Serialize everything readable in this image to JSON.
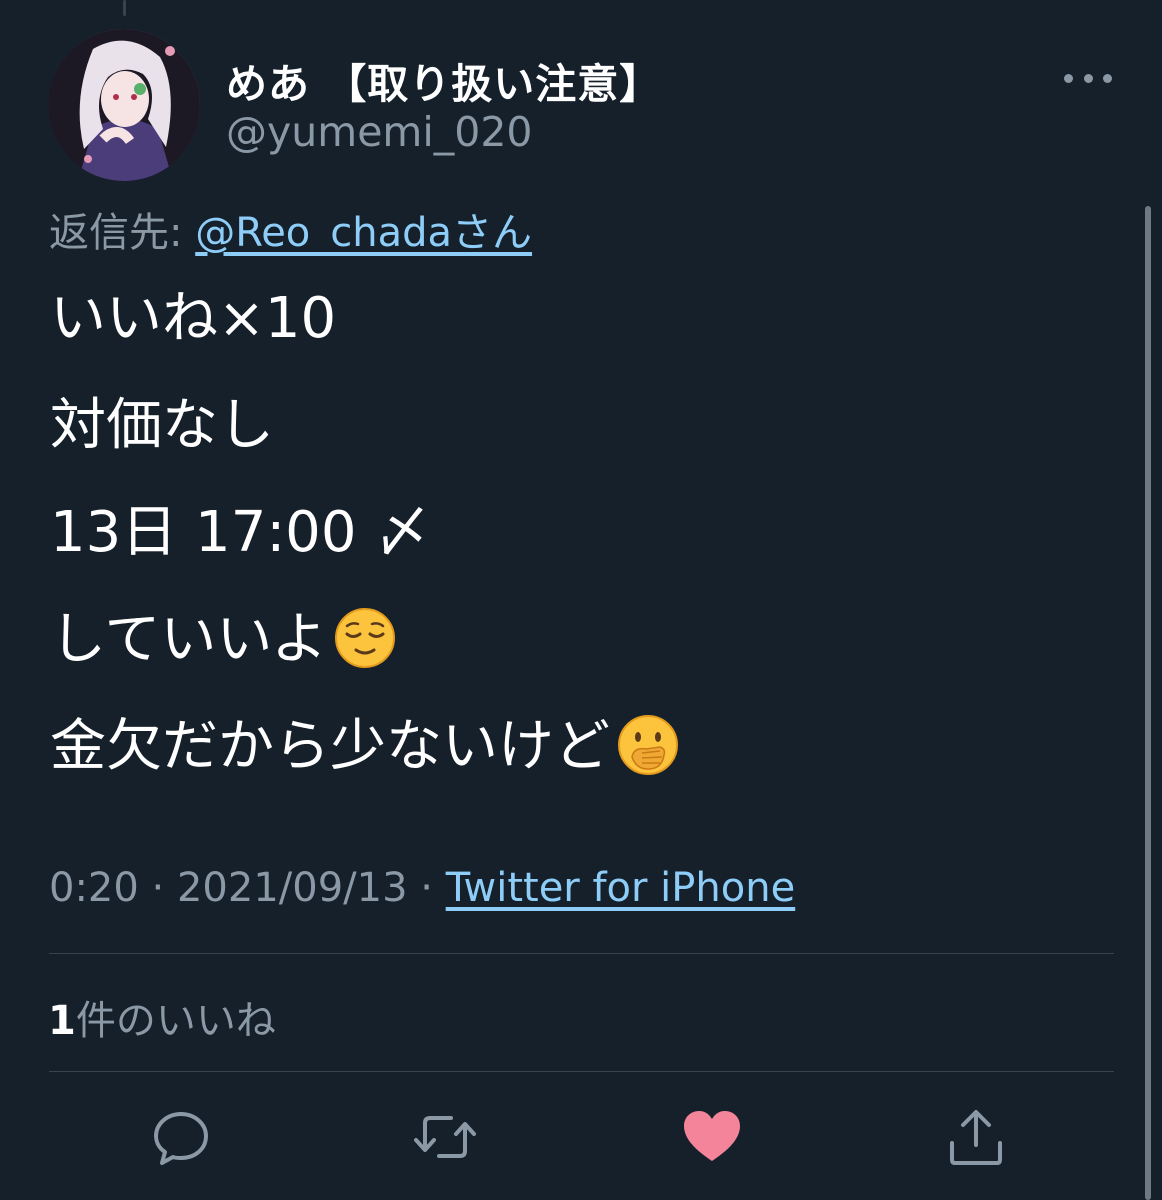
{
  "tweet": {
    "author": {
      "display_name": "めあ 【取り扱い注意】",
      "handle": "@yumemi_020"
    },
    "reply_prefix": "返信先: ",
    "reply_to": "@Reo_chadaさん",
    "lines": [
      "いいね×10",
      "対価なし",
      "13日 17:00 〆",
      "していいよ",
      "金欠だから少ないけど"
    ],
    "emojis": {
      "line4": "relieved-face",
      "line5": "face-with-hand-over-mouth"
    },
    "time": "0:20",
    "separator": " · ",
    "date": "2021/09/13",
    "source": "Twitter for iPhone",
    "likes": {
      "count": "1",
      "label": "件のいいね"
    },
    "liked": true
  },
  "colors": {
    "background": "#15202b",
    "text_primary": "#ffffff",
    "text_secondary": "#8b98a5",
    "link": "#8ecdf8",
    "like_active": "#f4849a",
    "divider": "#38444d"
  },
  "icons": [
    "more-options-icon",
    "reply-icon",
    "retweet-icon",
    "like-icon",
    "share-icon"
  ]
}
